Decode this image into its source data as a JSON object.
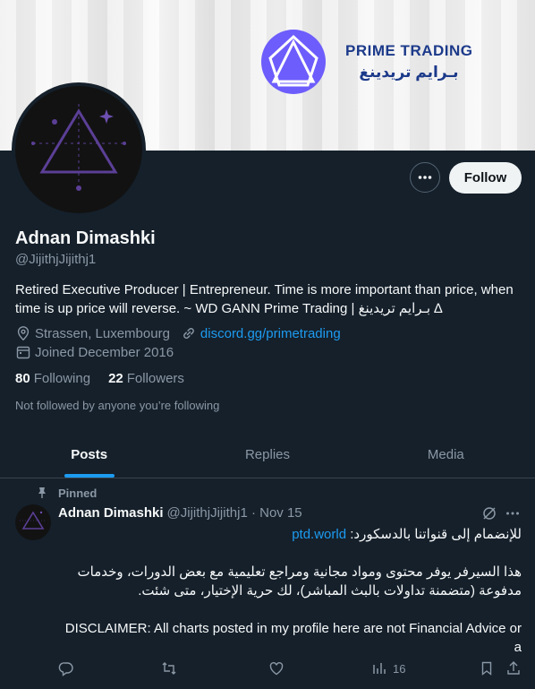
{
  "banner": {
    "brand_en": "PRIME  TRADING",
    "brand_ar": "بـرايم تريدينغ",
    "brand_color": "#1c3a8a",
    "logo_color": "#6d5dfc"
  },
  "profile": {
    "name": "Adnan Dimashki",
    "handle": "@JijithjJijithj1",
    "bio": "Retired Executive Producer | Entrepreneur. Time is more important than price, when time is up price will reverse. ~ WD GANN Prime Trading | بـرايم تريدينغ ∆",
    "location": "Strassen, Luxembourg",
    "website": "discord.gg/primetrading",
    "joined": "Joined December 2016",
    "following_count": "80",
    "following_label": "Following",
    "followers_count": "22",
    "followers_label": "Followers",
    "not_followed": "Not followed by anyone you’re following",
    "follow_label": "Follow"
  },
  "tabs": [
    {
      "label": "Posts",
      "active": true
    },
    {
      "label": "Replies",
      "active": false
    },
    {
      "label": "Media",
      "active": false
    }
  ],
  "post": {
    "pinned_label": "Pinned",
    "author": "Adnan Dimashki",
    "handle_date": "@JijithjJijithj1 · Nov 15",
    "line1_prefix": "للإنضمام إلى قنواتنا بالدسكورد:",
    "line1_link": "ptd.world",
    "para2": "هذا السيرفر يوفر محتوى ومواد مجانية ومراجع تعليمية مع بعض الدورات، وخدمات مدفوعة (متضمنة تداولات بالبث المباشر)، لك حرية الإختيار، متى شئت.",
    "disclaimer": "DISCLAIMER: All charts posted in my profile here are not Financial Advice or a",
    "views": "16"
  },
  "colors": {
    "background": "#15202b",
    "accent": "#1d9bf0",
    "muted": "#8b98a5"
  }
}
